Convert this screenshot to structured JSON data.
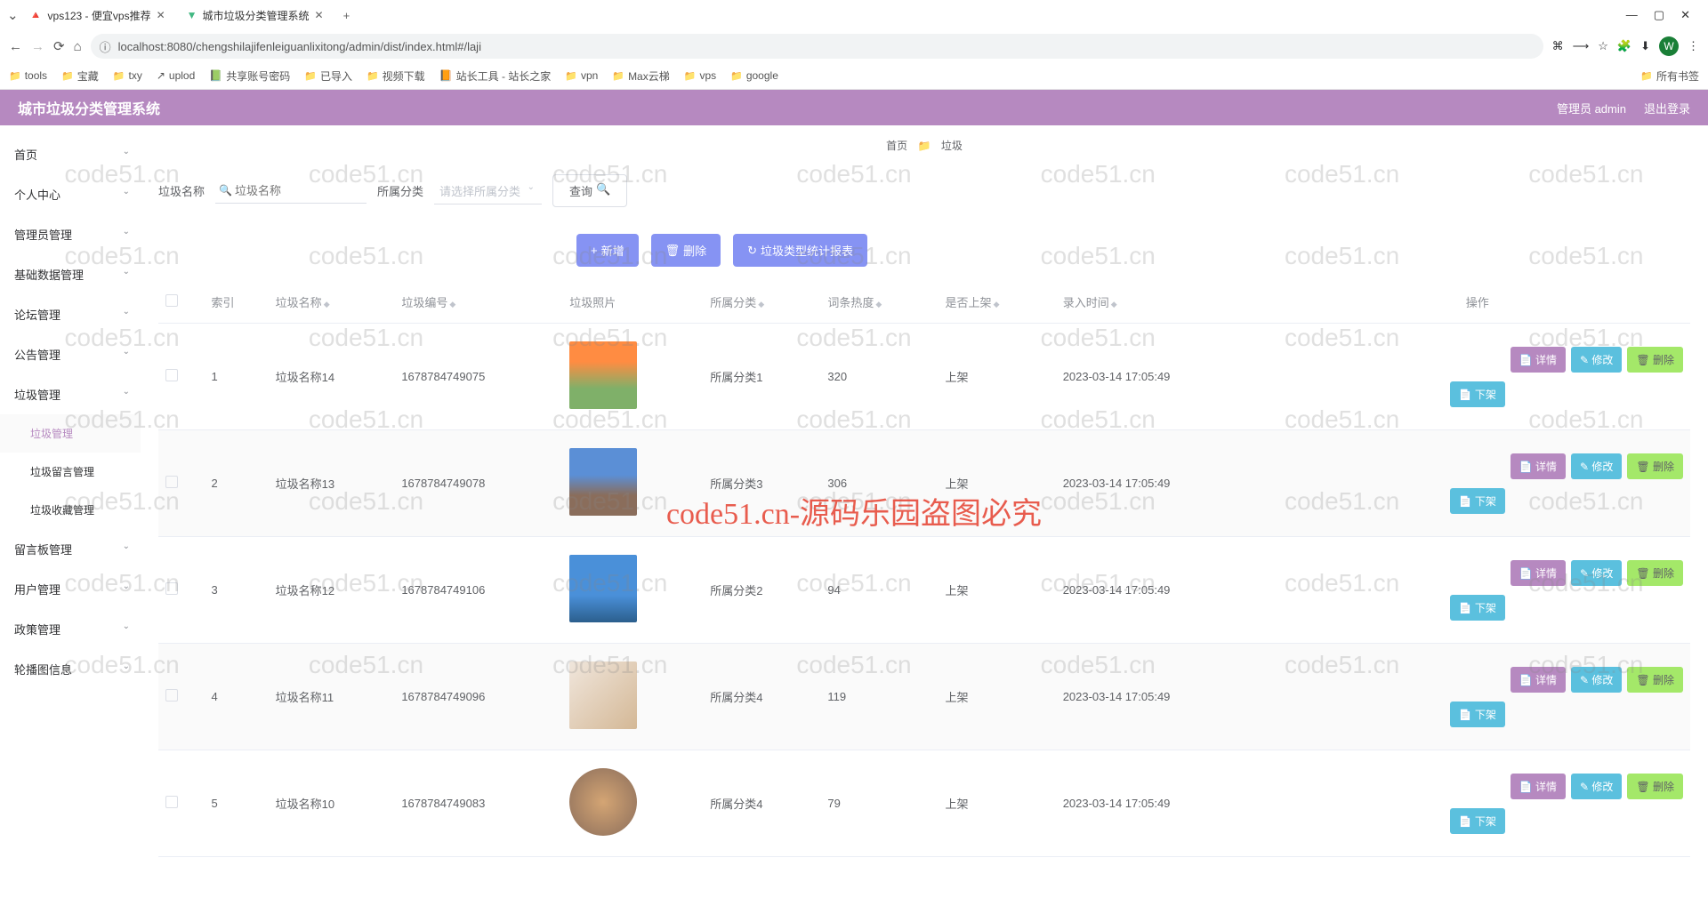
{
  "browser": {
    "tabs": [
      {
        "title": "vps123 - 便宜vps推荐"
      },
      {
        "title": "城市垃圾分类管理系统"
      }
    ],
    "url": "localhost:8080/chengshilajifenleiguanlixitong/admin/dist/index.html#/laji",
    "avatar": "W",
    "bookmarks": [
      "tools",
      "宝藏",
      "txy",
      "uplod",
      "共享账号密码",
      "已导入",
      "视频下载",
      "站长工具 - 站长之家",
      "vpn",
      "Max云梯",
      "vps",
      "google"
    ],
    "all_bookmarks": "所有书签"
  },
  "header": {
    "title": "城市垃圾分类管理系统",
    "admin_label": "管理员 admin",
    "logout": "退出登录"
  },
  "sidebar": {
    "items": [
      {
        "label": "首页"
      },
      {
        "label": "个人中心"
      },
      {
        "label": "管理员管理"
      },
      {
        "label": "基础数据管理"
      },
      {
        "label": "论坛管理"
      },
      {
        "label": "公告管理"
      },
      {
        "label": "垃圾管理"
      },
      {
        "label": "垃圾管理",
        "sub": true,
        "active": true
      },
      {
        "label": "垃圾留言管理",
        "sub": true
      },
      {
        "label": "垃圾收藏管理",
        "sub": true
      },
      {
        "label": "留言板管理"
      },
      {
        "label": "用户管理"
      },
      {
        "label": "政策管理"
      },
      {
        "label": "轮播图信息"
      }
    ]
  },
  "breadcrumb": {
    "home": "首页",
    "sep": "📁",
    "current": "垃圾"
  },
  "search": {
    "name_label": "垃圾名称",
    "name_placeholder": "垃圾名称",
    "cat_label": "所属分类",
    "cat_placeholder": "请选择所属分类",
    "btn": "查询"
  },
  "actions": {
    "add": "新增",
    "delete": "删除",
    "report": "垃圾类型统计报表"
  },
  "table": {
    "headers": {
      "index": "索引",
      "name": "垃圾名称",
      "code": "垃圾编号",
      "photo": "垃圾照片",
      "cat": "所属分类",
      "heat": "词条热度",
      "status": "是否上架",
      "time": "录入时间",
      "op": "操作"
    },
    "ops": {
      "detail": "详情",
      "edit": "修改",
      "delete": "删除",
      "down": "下架"
    },
    "rows": [
      {
        "idx": "1",
        "name": "垃圾名称14",
        "code": "1678784749075",
        "cat": "所属分类1",
        "heat": "320",
        "status": "上架",
        "time": "2023-03-14 17:05:49",
        "thumb": "t1"
      },
      {
        "idx": "2",
        "name": "垃圾名称13",
        "code": "1678784749078",
        "cat": "所属分类3",
        "heat": "306",
        "status": "上架",
        "time": "2023-03-14 17:05:49",
        "thumb": "t2"
      },
      {
        "idx": "3",
        "name": "垃圾名称12",
        "code": "1678784749106",
        "cat": "所属分类2",
        "heat": "94",
        "status": "上架",
        "time": "2023-03-14 17:05:49",
        "thumb": "t3"
      },
      {
        "idx": "4",
        "name": "垃圾名称11",
        "code": "1678784749096",
        "cat": "所属分类4",
        "heat": "119",
        "status": "上架",
        "time": "2023-03-14 17:05:49",
        "thumb": "t4"
      },
      {
        "idx": "5",
        "name": "垃圾名称10",
        "code": "1678784749083",
        "cat": "所属分类4",
        "heat": "79",
        "status": "上架",
        "time": "2023-03-14 17:05:49",
        "thumb": "t5"
      }
    ]
  },
  "watermark": {
    "text": "code51.cn",
    "banner": "code51.cn-源码乐园盗图必究"
  }
}
